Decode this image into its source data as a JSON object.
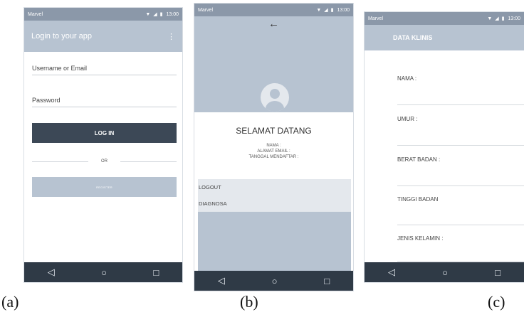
{
  "phone_a": {
    "status": {
      "carrier": "Marvel",
      "icons": "▼ ◢ ▮",
      "time": "13:00"
    },
    "appbar": {
      "title": "Login to your app",
      "menu_icon": "⋮"
    },
    "fields": {
      "username_label": "Username or Email",
      "password_label": "Password"
    },
    "login_label": "LOG IN",
    "or_label": "OR",
    "register_label": "REGISTER",
    "nav": {
      "back": "◁",
      "home": "○",
      "recent": "□"
    }
  },
  "phone_b": {
    "status": {
      "carrier": "Marvel",
      "icons": "▼ ◢ ▮",
      "time": "13:00"
    },
    "back_icon": "←",
    "welcome": "SELAMAT DATANG",
    "info": {
      "name": "NAMA :",
      "email": "ALAMAT EMAIL :",
      "date": "TANGGAL MENDAFTAR :"
    },
    "menu": [
      {
        "label": "LOGOUT"
      },
      {
        "label": "DIAGNOSA"
      }
    ],
    "nav": {
      "back": "◁",
      "home": "○",
      "recent": "□"
    }
  },
  "phone_c": {
    "status": {
      "carrier": "Marvel",
      "icons": "▼ ◢ ▮",
      "time": "13:00"
    },
    "appbar_title": "DATA KLINIS",
    "fields": [
      {
        "label": "NAMA :"
      },
      {
        "label": "UMUR :"
      },
      {
        "label": "BERAT BADAN :"
      },
      {
        "label": "TINGGI BADAN"
      },
      {
        "label": "JENIS KELAMIN :"
      }
    ],
    "nav": {
      "back": "◁",
      "home": "○",
      "recent": "□"
    }
  },
  "captions": {
    "a": "(a)",
    "b": "(b)",
    "c": "(c)"
  }
}
